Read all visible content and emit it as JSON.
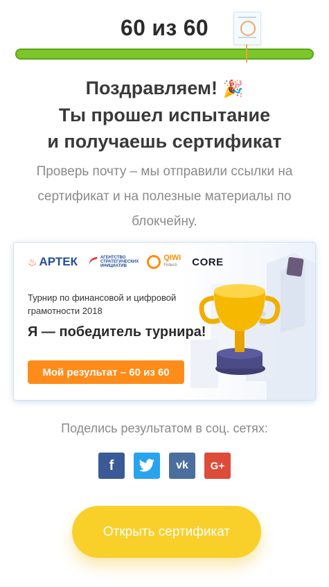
{
  "score": {
    "text": "60 из 60",
    "value": 60,
    "max": 60,
    "progress_fraction": 1.0
  },
  "headline": {
    "line1": "Поздравляем!",
    "line1_emoji": "🎉",
    "line2": "Ты прошел испытание",
    "line3": "и получаешь сертификат"
  },
  "subtitle": "Проверь почту – мы отправили ссылки на сертификат и на полезные материалы по блокчейну.",
  "banner": {
    "logos": {
      "artek": "АРТЕК",
      "asi": [
        "АГЕНТСТВО",
        "СТРАТЕГИЧЕСКИХ",
        "ИНИЦИАТИВ"
      ],
      "qiwi": "QIWI",
      "qiwi_sub": "Fintech",
      "core": "CORE"
    },
    "tournament": "Турнир по финансовой и цифровой грамотности 2018",
    "title": "Я — победитель турнира!",
    "result_button": "Мой результат – 60 из 60"
  },
  "share": {
    "title": "Поделись результатом в соц. сетях:",
    "buttons": [
      {
        "name": "facebook",
        "glyph": "f",
        "color": "#3a5a97"
      },
      {
        "name": "twitter",
        "glyph": "🐦",
        "color": "#2aa3ef"
      },
      {
        "name": "vk",
        "glyph": "vk",
        "color": "#4a6f9c"
      },
      {
        "name": "google-plus",
        "glyph": "G+",
        "color": "#dd4b39"
      }
    ]
  },
  "open_button": "Открыть сертификат",
  "colors": {
    "progress_fill": "#7cc52a",
    "accent_orange": "#ff8c1a",
    "open_button": "#f9cf2a"
  }
}
